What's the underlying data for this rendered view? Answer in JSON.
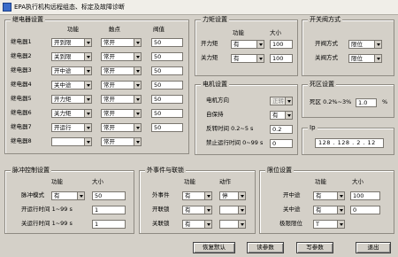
{
  "window": {
    "title": "EPA执行机构远程组态、标定及故障诊断"
  },
  "relay_group": {
    "title": "继电器设置",
    "col_function": "功能",
    "col_contact": "触点",
    "col_threshold": "阀值",
    "rows": [
      {
        "label": "继电器1",
        "function": "开到限",
        "contact": "常开",
        "threshold": "50"
      },
      {
        "label": "继电器2",
        "function": "关到限",
        "contact": "常开",
        "threshold": "50"
      },
      {
        "label": "继电器3",
        "function": "开中途",
        "contact": "常开",
        "threshold": "50"
      },
      {
        "label": "继电器4",
        "function": "关中途",
        "contact": "常开",
        "threshold": "50"
      },
      {
        "label": "继电器5",
        "function": "开力矩",
        "contact": "常开",
        "threshold": "50"
      },
      {
        "label": "继电器6",
        "function": "关力矩",
        "contact": "常开",
        "threshold": "50"
      },
      {
        "label": "继电器7",
        "function": "开运行",
        "contact": "常开",
        "threshold": "50"
      },
      {
        "label": "继电器8",
        "function": "",
        "contact": "常开",
        "threshold": ""
      }
    ]
  },
  "torque_group": {
    "title": "力矩设置",
    "col_function": "功能",
    "col_size": "大小",
    "rows": [
      {
        "label": "开力矩",
        "function": "有",
        "size": "100"
      },
      {
        "label": "关力矩",
        "function": "有",
        "size": "100"
      }
    ]
  },
  "valve_mode_group": {
    "title": "开关阀方式",
    "rows": [
      {
        "label": "开阀方式",
        "value": "限位"
      },
      {
        "label": "关阀方式",
        "value": "限位"
      }
    ]
  },
  "motor_group": {
    "title": "电机设置",
    "direction_label": "电机方向",
    "direction_value": "正转",
    "selflock_label": "自保持",
    "selflock_value": "有",
    "reverse_time_label": "反转时间 0.2~5 s",
    "reverse_time_value": "0.2",
    "stop_time_label": "禁止运行时间 0~99 s",
    "stop_time_value": "0"
  },
  "deadzone_group": {
    "title": "死区设置",
    "label": "死区 0.2%~3%",
    "value": "1.0",
    "unit": "%"
  },
  "ip_group": {
    "title": "Ip",
    "value": "128 . 128 . 2 . 12"
  },
  "pulse_group": {
    "title": "脉冲控制设置",
    "col_function": "功能",
    "col_size": "大小",
    "mode_label": "脉冲模式",
    "mode_function": "有",
    "mode_size": "50",
    "open_time_label": "开运行时间 1~99 s",
    "open_time_value": "1",
    "close_time_label": "关运行时间 1~99 s",
    "close_time_value": "1"
  },
  "external_group": {
    "title": "外事件与联锁",
    "col_function": "功能",
    "col_action": "动作",
    "rows": [
      {
        "label": "外事件",
        "function": "有",
        "action": "停"
      },
      {
        "label": "开联锁",
        "function": "有",
        "action": ""
      },
      {
        "label": "关联锁",
        "function": "有",
        "action": ""
      }
    ]
  },
  "limit_group": {
    "title": "限位设置",
    "col_function": "功能",
    "col_size": "大小",
    "rows": [
      {
        "label": "开中途",
        "function": "有",
        "size": "100"
      },
      {
        "label": "关中途",
        "function": "有",
        "size": "0"
      },
      {
        "label": "极限限位",
        "function": "T",
        "size": ""
      }
    ]
  },
  "buttons": {
    "restore": "恢复默认",
    "read": "读参数",
    "write": "写参数",
    "exit": "退出"
  }
}
